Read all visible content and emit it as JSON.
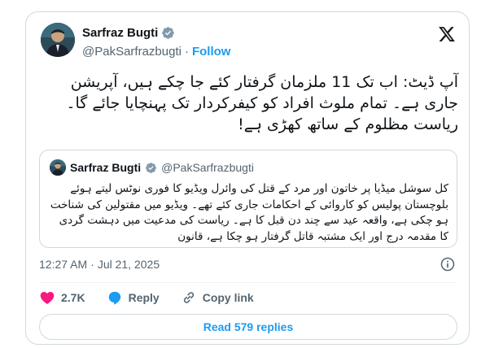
{
  "author": {
    "name": "Sarfraz Bugti",
    "handle": "@PakSarfrazbugti",
    "separator": "·",
    "follow_label": "Follow"
  },
  "tweet": {
    "text": "آپ ڈیٹ: اب تک 11 ملزمان گرفتار کئے جا چکے ہیں، آپریشن جاری ہے۔ تمام ملوث افراد کو کیفرکردار تک پہنچایا جائے گا۔ ریاست مظلوم کے ساتھ کھڑی ہے!"
  },
  "quoted_tweet": {
    "name": "Sarfraz Bugti",
    "handle": "@PakSarfrazbugti",
    "text": "کل سوشل میڈیا پر خاتون اور مرد کے قتل کی وائرل ویڈیو کا فوری نوٹس لیتے ہوئے بلوچستان پولیس کو کاروائی کے احکامات جاری کئے تھے۔ ویڈیو میں مقتولین کی شناخت ہو چکی ہے، واقعہ عید سے چند دن قبل کا ہے۔ ریاست کی مدعیت میں دہشت گردی کا مقدمہ درج اور ایک مشتبہ قاتل گرفتار ہو چکا ہے، قانون"
  },
  "meta": {
    "time": "12:27 AM",
    "separator": "·",
    "date": "Jul 21, 2025"
  },
  "actions": {
    "likes": "2.7K",
    "reply_label": "Reply",
    "copy_link_label": "Copy link"
  },
  "read_replies_label": "Read 579 replies",
  "colors": {
    "accent": "#1d9bf0",
    "like": "#f91880",
    "verified": "#829aab",
    "border": "#cfd9de",
    "muted": "#536471"
  },
  "icons": [
    "verified-badge-icon",
    "x-logo-icon",
    "info-icon",
    "heart-icon",
    "reply-bubble-icon",
    "link-icon"
  ]
}
